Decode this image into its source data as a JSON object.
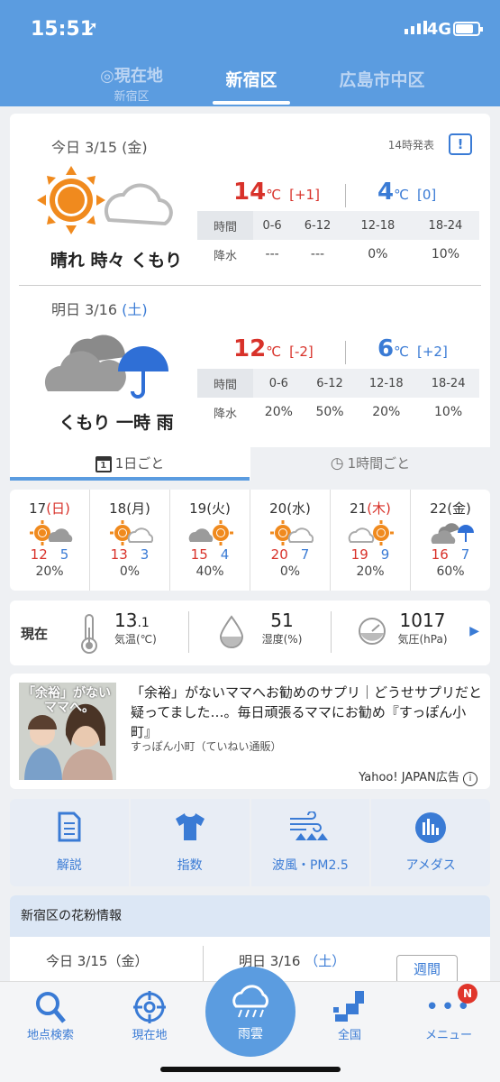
{
  "status": {
    "time": "15:51",
    "network": "4G"
  },
  "tabs": [
    {
      "label": "現在地",
      "sub": "新宿区"
    },
    {
      "label": "新宿区"
    },
    {
      "label": "広島市中区"
    }
  ],
  "today": {
    "date_prefix": "今日 3/15 (金)",
    "issued": "14時発表",
    "weather": "晴れ 時々 くもり",
    "high": "14",
    "high_unit": "℃",
    "high_diff": "[+1]",
    "low": "4",
    "low_unit": "℃",
    "low_diff": "[0]",
    "rain_header": [
      "時間",
      "0-6",
      "6-12",
      "12-18",
      "18-24"
    ],
    "rain_row": [
      "降水",
      "---",
      "---",
      "0%",
      "10%"
    ]
  },
  "tomorrow": {
    "date_prefix": "明日 3/16 ",
    "date_dow": "(土)",
    "weather": "くもり 一時 雨",
    "high": "12",
    "high_unit": "℃",
    "high_diff": "[-2]",
    "low": "6",
    "low_unit": "℃",
    "low_diff": "[+2]",
    "rain_header": [
      "時間",
      "0-6",
      "6-12",
      "12-18",
      "18-24"
    ],
    "rain_row": [
      "降水",
      "20%",
      "50%",
      "20%",
      "10%"
    ]
  },
  "mode_tabs": {
    "daily": "1日ごと",
    "hourly": "1時間ごと"
  },
  "week": [
    {
      "date": "17",
      "dow": "(日)",
      "hi": "12",
      "lo": "5",
      "pop": "20%"
    },
    {
      "date": "18",
      "dow": "(月)",
      "hi": "13",
      "lo": "3",
      "pop": "0%"
    },
    {
      "date": "19",
      "dow": "(火)",
      "hi": "15",
      "lo": "4",
      "pop": "40%"
    },
    {
      "date": "20",
      "dow": "(水)",
      "hi": "20",
      "lo": "7",
      "pop": "0%"
    },
    {
      "date": "21",
      "dow": "(木)",
      "hi": "19",
      "lo": "9",
      "pop": "20%"
    },
    {
      "date": "22",
      "dow": "(金)",
      "hi": "16",
      "lo": "7",
      "pop": "60%"
    }
  ],
  "current": {
    "label": "現在",
    "temp": "13",
    "temp_dec": ".1",
    "temp_unit": "気温(℃)",
    "humidity": "51",
    "humidity_unit": "湿度(%)",
    "pressure": "1017",
    "pressure_unit": "気圧(hPa)"
  },
  "ad": {
    "image_text_1": "「余裕」がない",
    "image_text_2": "ママへ。",
    "title": "「余裕」がないママへお勧めのサプリ｜どうせサプリだと疑ってました…。毎日頑張るママにお勧め『すっぽん小町』",
    "source": "すっぽん小町（ていねい通販）",
    "label": "Yahoo! JAPAN広告"
  },
  "menu": [
    "解説",
    "指数",
    "波風・PM2.5",
    "アメダス"
  ],
  "pollen": {
    "title": "新宿区の花粉情報",
    "today": "今日 3/15（金）",
    "tomorrow_prefix": "明日 3/16 ",
    "tomorrow_dow": "（土）",
    "week_button": "週間"
  },
  "bottom_nav": [
    "地点検索",
    "現在地",
    "雨雲",
    "全国",
    "メニュー"
  ],
  "badge": "N"
}
